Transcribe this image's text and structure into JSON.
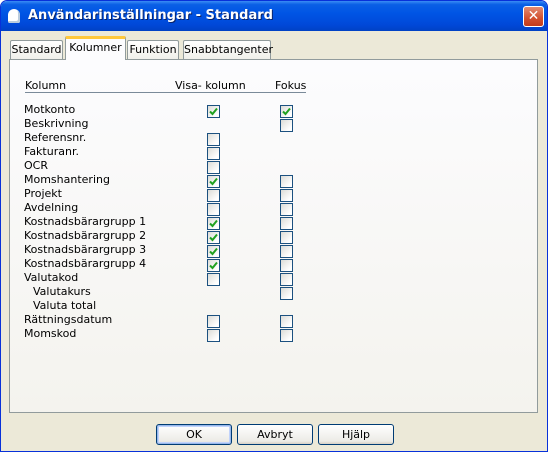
{
  "window": {
    "title": "Användarinställningar - Standard",
    "close_label": "✕"
  },
  "tabs": [
    {
      "label": "Standard"
    },
    {
      "label": "Kolumner"
    },
    {
      "label": "Funktion"
    },
    {
      "label": "Snabbtangenter"
    }
  ],
  "active_tab": "Kolumner",
  "table": {
    "headers": {
      "column": "Kolumn",
      "show": "Visa- kolumn",
      "focus": "Fokus"
    },
    "rows": [
      {
        "label": "Motkonto",
        "show": true,
        "focus": true
      },
      {
        "label": "Beskrivning",
        "show": null,
        "focus": false
      },
      {
        "label": "Referensnr.",
        "show": false,
        "focus": null
      },
      {
        "label": "Fakturanr.",
        "show": false,
        "focus": null
      },
      {
        "label": "OCR",
        "show": false,
        "focus": null
      },
      {
        "label": "Momshantering",
        "show": true,
        "focus": false
      },
      {
        "label": "Projekt",
        "show": false,
        "focus": false
      },
      {
        "label": "Avdelning",
        "show": false,
        "focus": false
      },
      {
        "label": "Kostnadsbärargrupp 1",
        "show": true,
        "focus": false
      },
      {
        "label": "Kostnadsbärargrupp 2",
        "show": true,
        "focus": false
      },
      {
        "label": "Kostnadsbärargrupp 3",
        "show": true,
        "focus": false
      },
      {
        "label": "Kostnadsbärargrupp 4",
        "show": true,
        "focus": false
      },
      {
        "label": "Valutakod",
        "show": false,
        "focus": false
      },
      {
        "label": "Valutakurs",
        "show": null,
        "focus": false
      },
      {
        "label": "Valuta total",
        "show": null,
        "focus": null
      },
      {
        "label": "Rättningsdatum",
        "show": false,
        "focus": false
      },
      {
        "label": "Momskod",
        "show": false,
        "focus": false
      }
    ]
  },
  "buttons": {
    "ok": "OK",
    "cancel": "Avbryt",
    "help": "Hjälp"
  }
}
